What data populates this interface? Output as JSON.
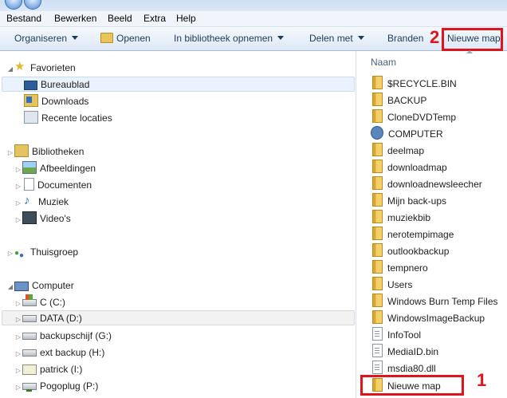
{
  "menu": [
    "Bestand",
    "Bewerken",
    "Beeld",
    "Extra",
    "Help"
  ],
  "toolbar": {
    "organize": "Organiseren",
    "open": "Openen",
    "include_library": "In bibliotheek opnemen",
    "share_with": "Delen met",
    "burn": "Branden",
    "new_folder": "Nieuwe map"
  },
  "annotations": {
    "one": "1",
    "two": "2"
  },
  "nav": {
    "favorites": {
      "label": "Favorieten",
      "items": [
        "Bureaublad",
        "Downloads",
        "Recente locaties"
      ]
    },
    "libraries": {
      "label": "Bibliotheken",
      "items": [
        "Afbeeldingen",
        "Documenten",
        "Muziek",
        "Video's"
      ]
    },
    "homegroup": {
      "label": "Thuisgroep"
    },
    "computer": {
      "label": "Computer",
      "items": [
        "C (C:)",
        "DATA (D:)",
        "backupschijf (G:)",
        "ext backup (H:)",
        "patrick (I:)",
        "Pogoplug (P:)"
      ]
    }
  },
  "files": {
    "column_name": "Naam",
    "items": [
      "$RECYCLE.BIN",
      "BACKUP",
      "CloneDVDTemp",
      "COMPUTER",
      "deelmap",
      "downloadmap",
      "downloadnewsleecher",
      "Mijn back-ups",
      "muziekbib",
      "nerotempimage",
      "outlookbackup",
      "tempnero",
      "Users",
      "Windows Burn Temp Files",
      "WindowsImageBackup",
      "InfoTool",
      "MediaID.bin",
      "msdia80.dll",
      "Nieuwe map"
    ]
  }
}
